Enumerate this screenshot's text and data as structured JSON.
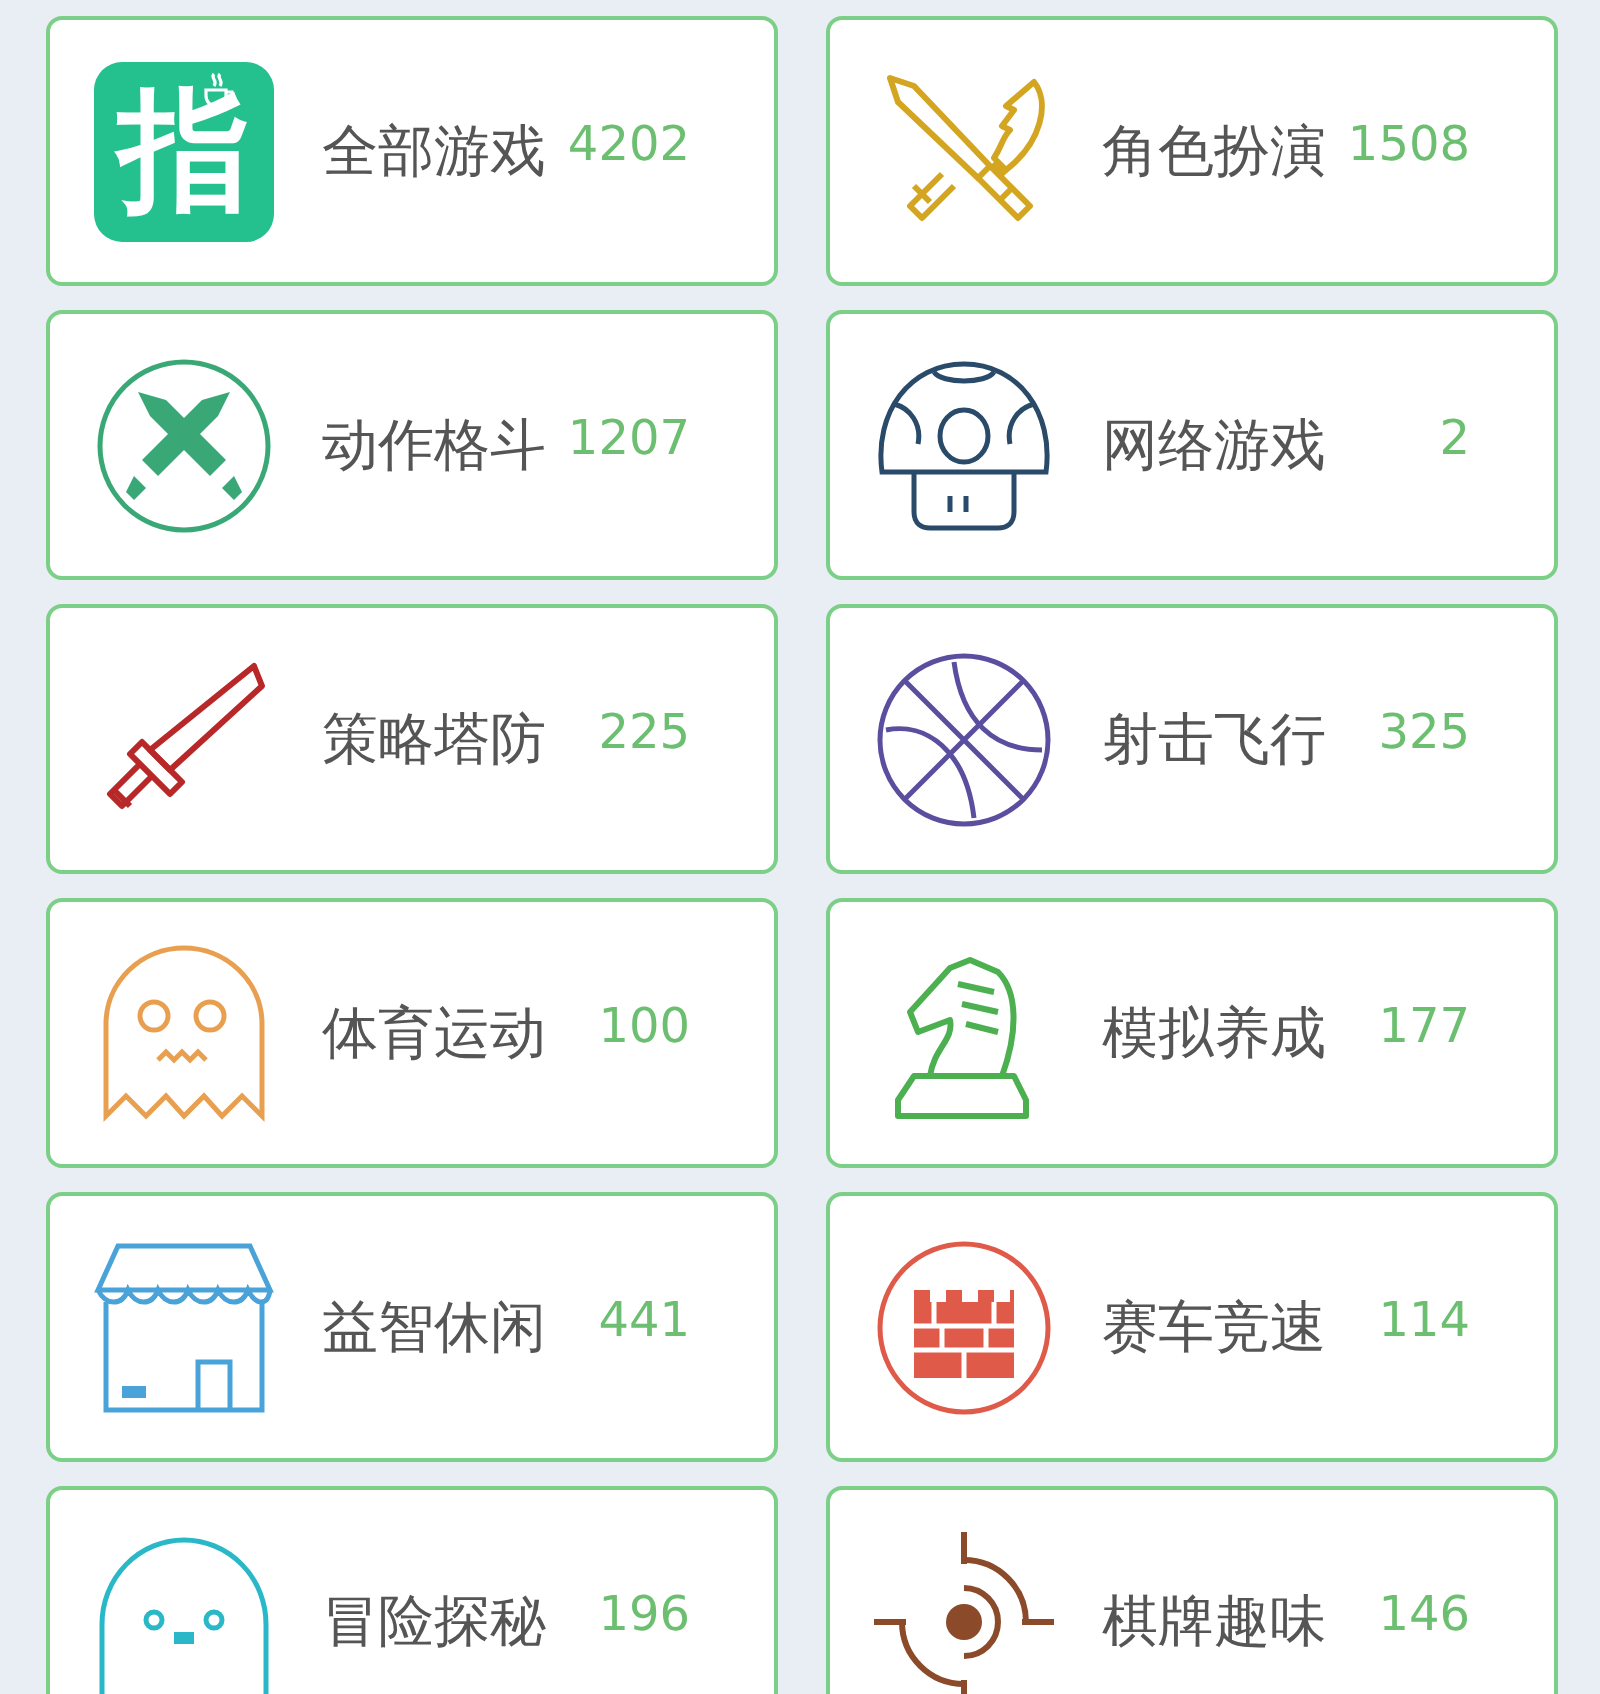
{
  "categories": [
    {
      "name": "全部游戏",
      "count": "4202",
      "logo_text": "指"
    },
    {
      "name": "角色扮演",
      "count": "1508"
    },
    {
      "name": "动作格斗",
      "count": "1207"
    },
    {
      "name": "网络游戏",
      "count": "2"
    },
    {
      "name": "策略塔防",
      "count": "225"
    },
    {
      "name": "射击飞行",
      "count": "325"
    },
    {
      "name": "体育运动",
      "count": "100"
    },
    {
      "name": "模拟养成",
      "count": "177"
    },
    {
      "name": "益智休闲",
      "count": "441"
    },
    {
      "name": "赛车竞速",
      "count": "114"
    },
    {
      "name": "冒险探秘",
      "count": "196"
    },
    {
      "name": "棋牌趣味",
      "count": "146"
    }
  ]
}
